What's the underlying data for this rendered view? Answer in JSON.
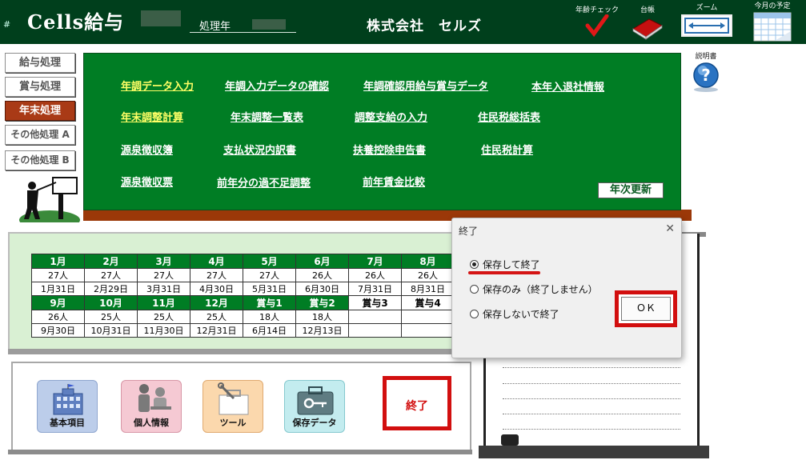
{
  "header": {
    "hash": "#",
    "app_title": "Cells給与",
    "processing_year_label": "処理年",
    "company": "株式会社　セルズ",
    "age_check_label": "年齢チェック",
    "ledger_label": "台帳",
    "zoom_label": "ズーム",
    "schedule_label": "今月の予定",
    "manual_label": "説明書"
  },
  "nav": {
    "salary": "給与処理",
    "bonus": "賞与処理",
    "year_end": "年末処理",
    "other_a": "その他処理 A",
    "other_b": "その他処理 B"
  },
  "menu": {
    "row1": [
      "年調データ入力",
      "年調入力データの確認",
      "年調確認用給与賞与データ",
      "本年入退社情報"
    ],
    "row2": [
      "年末調整計算",
      "年末調整一覧表",
      "調整支給の入力",
      "住民税総括表"
    ],
    "row3": [
      "源泉徴収簿",
      "支払状況内訳書",
      "扶養控除申告書",
      "住民税計算"
    ],
    "row4": [
      "源泉徴収票",
      "前年分の過不足調整",
      "前年賃金比較"
    ],
    "annual_update": "年次更新"
  },
  "calendar": {
    "top_headers": [
      "1月",
      "2月",
      "3月",
      "4月",
      "5月",
      "6月",
      "7月",
      "8月"
    ],
    "top_counts": [
      "27人",
      "27人",
      "27人",
      "27人",
      "27人",
      "26人",
      "26人",
      "26人"
    ],
    "top_dates": [
      "1月31日",
      "2月29日",
      "3月31日",
      "4月30日",
      "5月31日",
      "6月30日",
      "7月31日",
      "8月31日"
    ],
    "bottom_headers": [
      "9月",
      "10月",
      "11月",
      "12月",
      "賞与1",
      "賞与2",
      "賞与3",
      "賞与4"
    ],
    "bottom_counts": [
      "26人",
      "25人",
      "25人",
      "25人",
      "18人",
      "18人",
      "",
      ""
    ],
    "bottom_dates": [
      "9月30日",
      "10月31日",
      "11月30日",
      "12月31日",
      "6月14日",
      "12月13日",
      "",
      ""
    ]
  },
  "bottom": {
    "basic_items": "基本項目",
    "personal_info": "個人情報",
    "tools": "ツール",
    "saved_data": "保存データ",
    "end_button": "終了"
  },
  "dialog": {
    "title": "終了",
    "options": [
      "保存して終了",
      "保存のみ（終了しません）",
      "保存しないで終了"
    ],
    "selected_index": 0,
    "ok_label": "ＯＫ"
  },
  "colors": {
    "header_bg": "#003f1c",
    "menu_bg": "#007d24",
    "menu_highlight": "#ffff66",
    "accent_red": "#d20f0f",
    "active_nav": "#a93a16"
  }
}
